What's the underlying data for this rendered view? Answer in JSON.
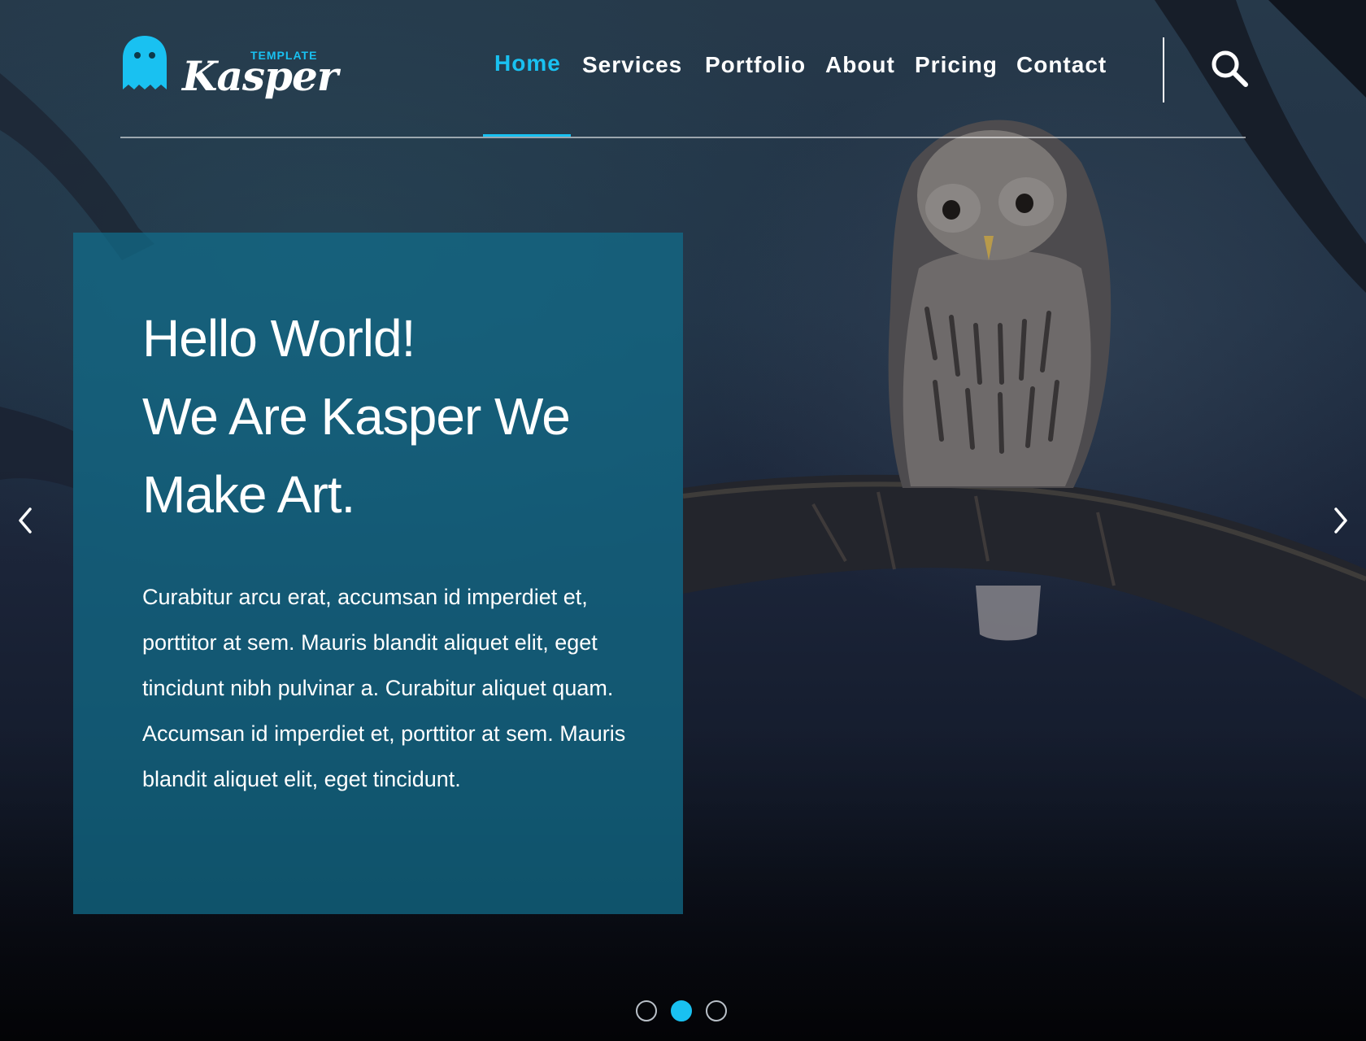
{
  "brand": {
    "name": "Kasper",
    "tag": "TEMPLATE",
    "accent_color": "#19c1f1"
  },
  "nav": {
    "items": [
      {
        "label": "Home",
        "active": true
      },
      {
        "label": "Services",
        "active": false
      },
      {
        "label": "Portfolio",
        "active": false
      },
      {
        "label": "About",
        "active": false
      },
      {
        "label": "Pricing",
        "active": false
      },
      {
        "label": "Contact",
        "active": false
      }
    ],
    "search_icon": "search-icon"
  },
  "hero": {
    "title_lines": [
      "Hello World!",
      "We Are Kasper We",
      "Make Art."
    ],
    "body": "Curabitur arcu erat, accumsan id imperdiet et, porttitor at sem. Mauris blandit aliquet elit, eget tincidunt nibh pulvinar a. Curabitur aliquet quam. Accumsan id imperdiet et, porttitor at sem. Mauris blandit aliquet elit, eget tincidunt.",
    "caption_color": "#126c8a"
  },
  "slider": {
    "prev_icon": "chevron-left-icon",
    "next_icon": "chevron-right-icon",
    "slide_count": 3,
    "active_slide": 2
  }
}
